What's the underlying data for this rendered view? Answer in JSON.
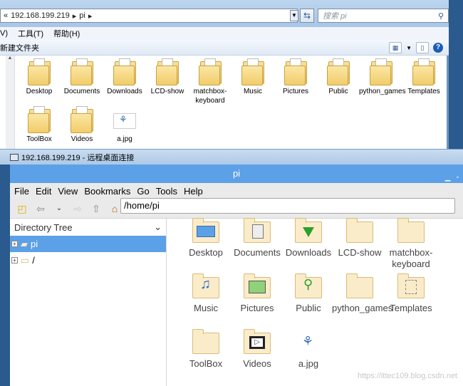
{
  "win7": {
    "address": "192.168.199.219",
    "crumb": "pi",
    "search_placeholder": "搜索 pi",
    "menu": [
      "V)",
      "工具(T)",
      "帮助(H)"
    ],
    "new_folder": "新建文件夹",
    "files": [
      {
        "name": "Desktop",
        "type": "folder"
      },
      {
        "name": "Documents",
        "type": "folder"
      },
      {
        "name": "Downloads",
        "type": "folder"
      },
      {
        "name": "LCD-show",
        "type": "folder"
      },
      {
        "name": "matchbox-keyboard",
        "type": "folder"
      },
      {
        "name": "Music",
        "type": "folder"
      },
      {
        "name": "Pictures",
        "type": "folder"
      },
      {
        "name": "Public",
        "type": "folder"
      },
      {
        "name": "python_games",
        "type": "folder"
      },
      {
        "name": "Templates",
        "type": "folder"
      },
      {
        "name": "ToolBox",
        "type": "folder"
      },
      {
        "name": "Videos",
        "type": "folder"
      },
      {
        "name": "a.jpg",
        "type": "file"
      }
    ]
  },
  "rdp": {
    "title": "192.168.199.219 - 远程桌面连接"
  },
  "lx": {
    "title": "pi",
    "menu": [
      "File",
      "Edit",
      "View",
      "Bookmarks",
      "Go",
      "Tools",
      "Help"
    ],
    "path": "/home/pi",
    "side_header": "Directory Tree",
    "tree": [
      {
        "label": "pi",
        "selected": true
      },
      {
        "label": "/",
        "selected": false
      }
    ],
    "files": [
      {
        "name": "Desktop",
        "icon": "desktop"
      },
      {
        "name": "Documents",
        "icon": "documents"
      },
      {
        "name": "Downloads",
        "icon": "downloads"
      },
      {
        "name": "LCD-show",
        "icon": "folder"
      },
      {
        "name": "matchbox-keyboard",
        "icon": "folder"
      },
      {
        "name": "Music",
        "icon": "music"
      },
      {
        "name": "Pictures",
        "icon": "pictures"
      },
      {
        "name": "Public",
        "icon": "public"
      },
      {
        "name": "python_games",
        "icon": "folder"
      },
      {
        "name": "Templates",
        "icon": "templates"
      },
      {
        "name": "ToolBox",
        "icon": "folder"
      },
      {
        "name": "Videos",
        "icon": "videos"
      },
      {
        "name": "a.jpg",
        "icon": "python"
      }
    ]
  },
  "watermark": "https://ittec109.blog.csdn.net"
}
